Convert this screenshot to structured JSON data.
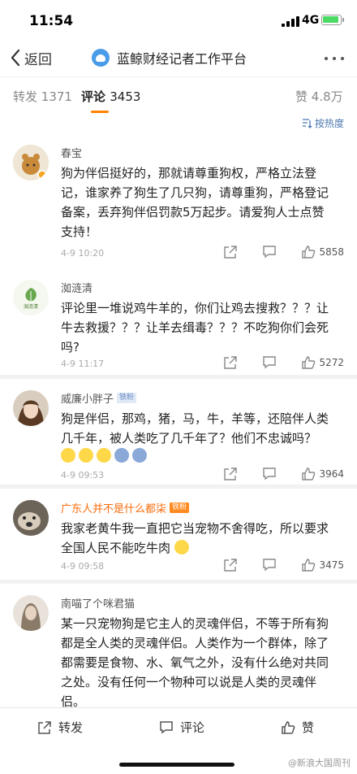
{
  "status": {
    "time": "11:54",
    "network": "4G"
  },
  "nav": {
    "back_label": "返回",
    "title": "蓝鲸财经记者工作平台"
  },
  "tabs": [
    {
      "label": "转发",
      "count": "1371"
    },
    {
      "label": "评论",
      "count": "3453"
    },
    {
      "label": "赞",
      "count": "4.8万"
    }
  ],
  "sort_label": "按热度",
  "comments": [
    {
      "user": "春宝",
      "badge": "",
      "text": "狗为伴侣挺好的，那就请尊重狗权，严格立法登记，谁家养了狗生了几只狗，请尊重狗，严格登记备案，丢弃狗伴侣罚款5万起步。请爱狗人士点赞支持！",
      "time": "4-9 10:20",
      "likes": "5858"
    },
    {
      "user": "洳涟清",
      "badge": "",
      "text": "评论里一堆说鸡牛羊的，你们让鸡去搜救？？？让牛去救援？？？让羊去缉毒？？？不吃狗你们会死吗?",
      "time": "4-9 11:17",
      "likes": "5272"
    },
    {
      "user": "威廉小胖子",
      "badge": "铁粉",
      "text": "狗是伴侣，那鸡，猪，马，牛，羊等，还陪伴人类几千年，被人类吃了几千年了？他们不忠诚吗？",
      "time": "4-9 09:53",
      "likes": "3964"
    },
    {
      "user": "广东人并不是什么都柒",
      "badge": "铁粉",
      "text": "我家老黄牛我一直把它当宠物不舍得吃，所以要求全国人民不能吃牛肉",
      "time": "4-9 09:58",
      "likes": "3475"
    },
    {
      "user": "南喵了个咪君猫",
      "badge": "",
      "text": "某一只宠物狗是它主人的灵魂伴侣，不等于所有狗都是全人类的灵魂伴侣。人类作为一个群体，除了都需要是食物、水、氧气之外，没有什么绝对共同之处。没有任何一个物种可以说是人类的灵魂伴侣。",
      "time": "",
      "likes": ""
    }
  ],
  "bottom": {
    "repost": "转发",
    "comment": "评论",
    "like": "赞"
  },
  "watermark": "@新浪大国周刊",
  "colors": {
    "accent": "#ff8200",
    "link": "#4a78b0",
    "highlight_user": "#f86c0c"
  }
}
